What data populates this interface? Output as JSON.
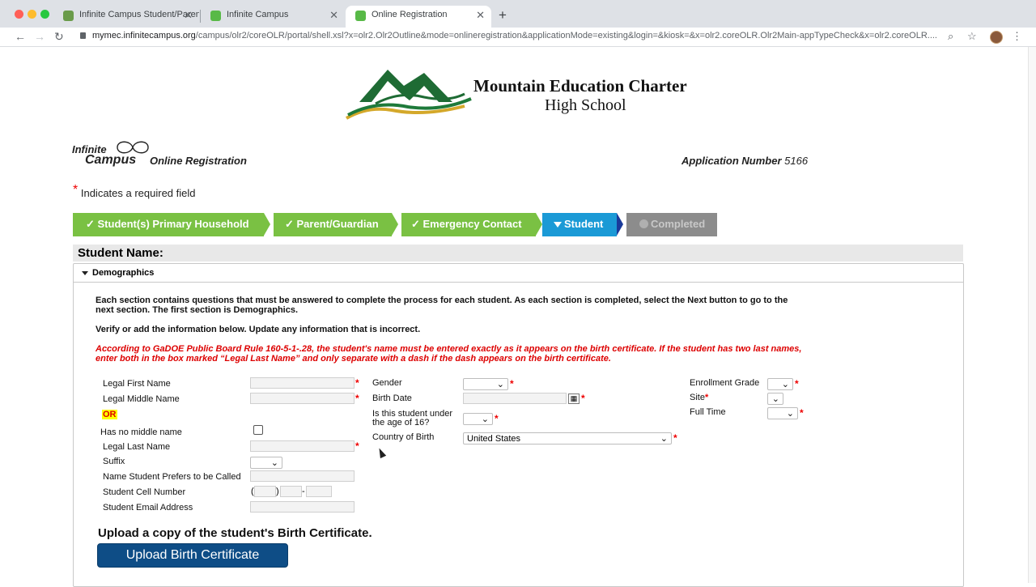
{
  "browser": {
    "tabs": [
      {
        "title": "Infinite Campus Student/Parent",
        "close": "✕"
      },
      {
        "title": "Infinite Campus",
        "close": "✕"
      },
      {
        "title": "Online Registration",
        "close": "✕"
      }
    ],
    "new_tab": "+",
    "url_host": "mymec.infinitecampus.org",
    "url_path": "/campus/olr2/coreOLR/portal/shell.xsl?x=olr2.Olr2Outline&mode=onlineregistration&applicationMode=existing&login=&kiosk=&x=olr2.coreOLR.Olr2Main-appTypeCheck&x=olr2.coreOLR...."
  },
  "school": {
    "line1": "Mountain Education Charter",
    "line2": "High School"
  },
  "ic": {
    "logo_line1": "Infinite",
    "logo_line2": "Campus",
    "product": "Online Registration"
  },
  "application": {
    "label": "Application Number",
    "number": "5166"
  },
  "required_note": {
    "star": "*",
    "text": "Indicates a required field"
  },
  "steps": [
    {
      "label": "✓ Student(s) Primary Household"
    },
    {
      "label": "✓ Parent/Guardian"
    },
    {
      "label": "✓ Emergency Contact"
    },
    {
      "label": "Student"
    },
    {
      "label": "Completed"
    }
  ],
  "colors": {
    "step_done": "#7ac143",
    "step_active": "#1b9ad6",
    "step_pending": "#8c8c8c",
    "required": "#e00000",
    "upload_btn": "#0e4d86"
  },
  "section_title": "Student Name:",
  "demographics": {
    "title": "Demographics",
    "intro1": "Each section contains questions that must be answered to complete the process for each student. As each section is completed, select the Next button to go to the next section. The first section is Demographics.",
    "intro2": "Verify or add the information below. Update any information that is incorrect.",
    "rule": "According to GaDOE Public Board Rule 160-5-1-.28, the student's name must be entered exactly as it appears on the birth certificate. If the student has two last names, enter both in the box marked “Legal Last Name” and only separate with a dash if the dash appears on the birth certificate."
  },
  "fields": {
    "legal_first_name": "Legal First Name",
    "legal_middle_name": "Legal Middle Name",
    "or": "OR",
    "no_middle_name": "Has no middle name",
    "legal_last_name": "Legal Last Name",
    "suffix": "Suffix",
    "preferred_name": "Name Student Prefers to be Called",
    "cell_number": "Student Cell Number",
    "email": "Student Email Address",
    "gender": "Gender",
    "birth_date": "Birth Date",
    "under_16_l1": "Is this student under",
    "under_16_l2": "the age of 16?",
    "country_of_birth": "Country of Birth",
    "country_value": "United States",
    "enrollment_grade": "Enrollment Grade",
    "site": "Site",
    "full_time": "Full Time",
    "phone_open": "(",
    "phone_close": ")",
    "phone_dash": "-"
  },
  "upload": {
    "title": "Upload a copy of the student's Birth Certificate.",
    "button": "Upload Birth Certificate"
  }
}
